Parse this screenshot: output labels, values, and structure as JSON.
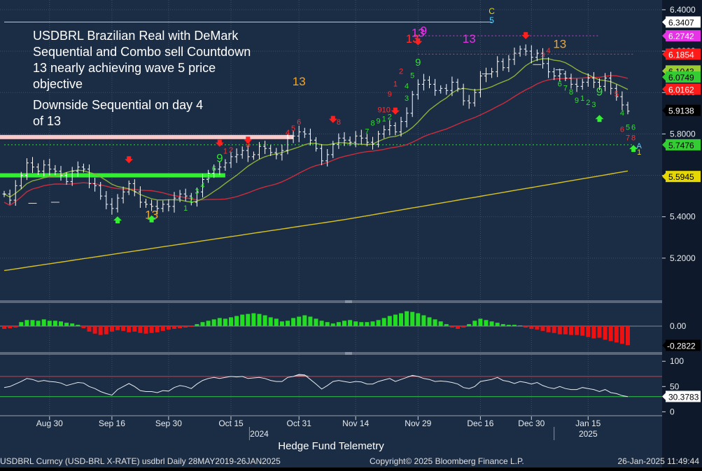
{
  "chart_data": {
    "type": "ohlc",
    "annotation_1": "USDBRL Brazilian Real with DeMark\nSequential and Combo sell Countdown\n13 nearly achieving wave 5 price\nobjective",
    "annotation_2": "Downside Sequential on day 4\nof 13",
    "price_ylim": [
      5.0,
      6.42
    ],
    "price_ticks": [
      "6.4000",
      "6.2000",
      "6.0000",
      "5.8000",
      "5.6000",
      "5.4000",
      "5.2000"
    ],
    "price_tick_values": [
      6.4,
      6.2,
      6.0,
      5.8,
      5.6,
      5.4,
      5.2
    ],
    "price_badges": [
      {
        "label": "6.3407",
        "value": 6.3407,
        "color": "#ffffff",
        "text": "#000000"
      },
      {
        "label": "6.2742",
        "value": 6.2742,
        "color": "#e533e5",
        "text": "#ffffff"
      },
      {
        "label": "6.1854",
        "value": 6.1854,
        "color": "#ff1a1a",
        "text": "#ffffff"
      },
      {
        "label": "6.1043",
        "value": 6.1043,
        "color": "#9acd32",
        "text": "#000000"
      },
      {
        "label": "6.0749",
        "value": 6.0749,
        "color": "#33cc33",
        "text": "#000000"
      },
      {
        "label": "6.0162",
        "value": 6.0162,
        "color": "#ff1a1a",
        "text": "#ffffff"
      },
      {
        "label": "5.9138",
        "value": 5.9138,
        "color": "#000000",
        "text": "#ffffff"
      },
      {
        "label": "5.7476",
        "value": 5.7476,
        "color": "#33cc33",
        "text": "#000000"
      },
      {
        "label": "5.5945",
        "value": 5.5945,
        "color": "#e6d800",
        "text": "#000000"
      }
    ],
    "x_labels": [
      {
        "label": "Aug 30",
        "bar": 8
      },
      {
        "label": "Sep 16",
        "bar": 19
      },
      {
        "label": "Sep 30",
        "bar": 29
      },
      {
        "label": "Oct 15",
        "bar": 40
      },
      {
        "label": "Oct 31",
        "bar": 52
      },
      {
        "label": "Nov 14",
        "bar": 62
      },
      {
        "label": "Nov 29",
        "bar": 73
      },
      {
        "label": "Dec 16",
        "bar": 84
      },
      {
        "label": "Dec 30",
        "bar": 93
      },
      {
        "label": "Jan 15",
        "bar": 103
      }
    ],
    "years": [
      {
        "label": "2024",
        "bar": 45
      },
      {
        "label": "2025",
        "bar": 103
      }
    ],
    "series": [
      {
        "name": "USDBRL",
        "closes": [
          5.51,
          5.48,
          5.55,
          5.6,
          5.66,
          5.64,
          5.62,
          5.65,
          5.63,
          5.62,
          5.6,
          5.57,
          5.62,
          5.64,
          5.63,
          5.56,
          5.55,
          5.5,
          5.46,
          5.44,
          5.49,
          5.52,
          5.56,
          5.52,
          5.47,
          5.46,
          5.45,
          5.44,
          5.46,
          5.45,
          5.49,
          5.51,
          5.5,
          5.47,
          5.52,
          5.58,
          5.61,
          5.63,
          5.64,
          5.66,
          5.69,
          5.7,
          5.72,
          5.69,
          5.7,
          5.74,
          5.73,
          5.71,
          5.7,
          5.72,
          5.78,
          5.79,
          5.81,
          5.8,
          5.77,
          5.73,
          5.67,
          5.7,
          5.75,
          5.78,
          5.77,
          5.76,
          5.79,
          5.78,
          5.76,
          5.75,
          5.8,
          5.82,
          5.84,
          5.81,
          5.86,
          5.9,
          5.99,
          6.04,
          6.06,
          6.04,
          6.01,
          6.02,
          6.01,
          6.05,
          6.02,
          5.96,
          5.95,
          6.0,
          6.08,
          6.09,
          6.1,
          6.15,
          6.12,
          6.16,
          6.19,
          6.21,
          6.2,
          6.17,
          6.19,
          6.14,
          6.1,
          6.08,
          6.09,
          6.07,
          6.04,
          6.03,
          6.05,
          6.07,
          6.05,
          6.03,
          6.07,
          6.02,
          5.98,
          5.94,
          5.91
        ]
      },
      {
        "name": "MA short",
        "color": "#8db03a"
      },
      {
        "name": "MA mid",
        "color": "#cc2c3c"
      },
      {
        "name": "MA long",
        "color": "#d8c21e"
      }
    ],
    "td_levels": [
      {
        "value": 6.3407,
        "color": "#7ae8d8",
        "style": "solid"
      },
      {
        "value": 6.2742,
        "color": "#e533e5",
        "style": "dotted"
      },
      {
        "value": 6.1854,
        "color": "#ff3030",
        "style": "dotted"
      },
      {
        "value": 5.7476,
        "color": "#33dd33",
        "style": "dotted"
      }
    ],
    "td_labels": [
      {
        "text": "C",
        "color": "#e6d800"
      },
      {
        "text": "5",
        "color": "#5bd3ff"
      },
      {
        "text": "13",
        "color": "#f5a623"
      },
      {
        "text": "13",
        "color": "#f5a623"
      },
      {
        "text": "13",
        "color": "#f5a623"
      },
      {
        "text": "13",
        "color": "#ff3030"
      },
      {
        "text": "13",
        "color": "#e533e5"
      },
      {
        "text": "13",
        "color": "#e533e5"
      },
      {
        "text": "9",
        "color": "#e533e5"
      },
      {
        "text": "9",
        "color": "#33dd33"
      },
      {
        "text": "9",
        "color": "#33dd33"
      },
      {
        "text": "9",
        "color": "#33dd33"
      },
      {
        "text": "910",
        "color": "#ff3030"
      },
      {
        "text": "A",
        "color": "#5bd3ff"
      },
      {
        "text": "1",
        "color": "#e6d800"
      }
    ],
    "macd_ylim": [
      -0.37,
      0.33
    ],
    "macd_tick_label": "0.00",
    "macd_badge": "-0.2822",
    "macd_values": [
      -0.04,
      -0.03,
      -0.02,
      0.06,
      0.09,
      0.09,
      0.08,
      0.1,
      0.08,
      0.08,
      0.07,
      0.05,
      0.04,
      0.02,
      -0.03,
      -0.08,
      -0.11,
      -0.13,
      -0.12,
      -0.08,
      -0.06,
      -0.07,
      -0.09,
      -0.08,
      -0.1,
      -0.11,
      -0.1,
      -0.09,
      -0.07,
      -0.05,
      -0.04,
      -0.03,
      -0.02,
      -0.01,
      0.03,
      0.06,
      0.08,
      0.1,
      0.12,
      0.11,
      0.13,
      0.15,
      0.17,
      0.18,
      0.19,
      0.18,
      0.16,
      0.13,
      0.11,
      0.07,
      0.08,
      0.12,
      0.14,
      0.16,
      0.14,
      0.11,
      0.08,
      0.06,
      0.04,
      0.06,
      0.08,
      0.09,
      0.07,
      0.06,
      0.06,
      0.07,
      0.09,
      0.12,
      0.15,
      0.17,
      0.19,
      0.22,
      0.21,
      0.19,
      0.16,
      0.13,
      0.1,
      0.07,
      0.03,
      -0.02,
      -0.04,
      -0.02,
      0.03,
      0.08,
      0.11,
      0.09,
      0.07,
      0.05,
      0.03,
      0.02,
      0.02,
      0.01,
      -0.02,
      -0.04,
      -0.05,
      -0.07,
      -0.09,
      -0.1,
      -0.12,
      -0.12,
      -0.13,
      -0.13,
      -0.14,
      -0.16,
      -0.18,
      -0.17,
      -0.2,
      -0.22,
      -0.24,
      -0.26,
      -0.28
    ],
    "rsi_ylim": [
      -5,
      110
    ],
    "rsi_ticks": [
      "100",
      "50",
      "0"
    ],
    "rsi_tick_values": [
      100,
      50,
      0
    ],
    "rsi_levels": [
      70,
      30
    ],
    "rsi_badge": "30.3783",
    "rsi_values": [
      48,
      50,
      55,
      60,
      66,
      64,
      60,
      62,
      60,
      59,
      57,
      52,
      55,
      58,
      57,
      50,
      46,
      40,
      36,
      33,
      44,
      50,
      56,
      50,
      42,
      40,
      40,
      38,
      42,
      41,
      48,
      52,
      50,
      46,
      55,
      62,
      66,
      68,
      66,
      68,
      70,
      69,
      70,
      66,
      67,
      68,
      66,
      62,
      60,
      60,
      68,
      70,
      74,
      73,
      64,
      55,
      45,
      52,
      60,
      62,
      60,
      58,
      60,
      59,
      55,
      55,
      60,
      63,
      66,
      60,
      64,
      68,
      72,
      70,
      66,
      64,
      60,
      61,
      60,
      58,
      55,
      48,
      46,
      50,
      60,
      62,
      64,
      68,
      62,
      60,
      56,
      60,
      58,
      55,
      58,
      52,
      48,
      46,
      50,
      46,
      44,
      44,
      48,
      46,
      44,
      40,
      44,
      38,
      36,
      32,
      30
    ]
  },
  "footer": {
    "title": "Hedge Fund Telemetry",
    "left": "USDBRL Curncy (USD-BRL X-RATE) usdbrl  Daily 28MAY2019-26JAN2025",
    "center": "Copyright© 2025 Bloomberg Finance L.P.",
    "right": "26-Jan-2025 11:49:44"
  },
  "colors": {
    "background": "#1b2c45",
    "bar": "#ffffff",
    "up": "#22dd22",
    "down": "#ee1111",
    "grid": "#3c4d66"
  }
}
